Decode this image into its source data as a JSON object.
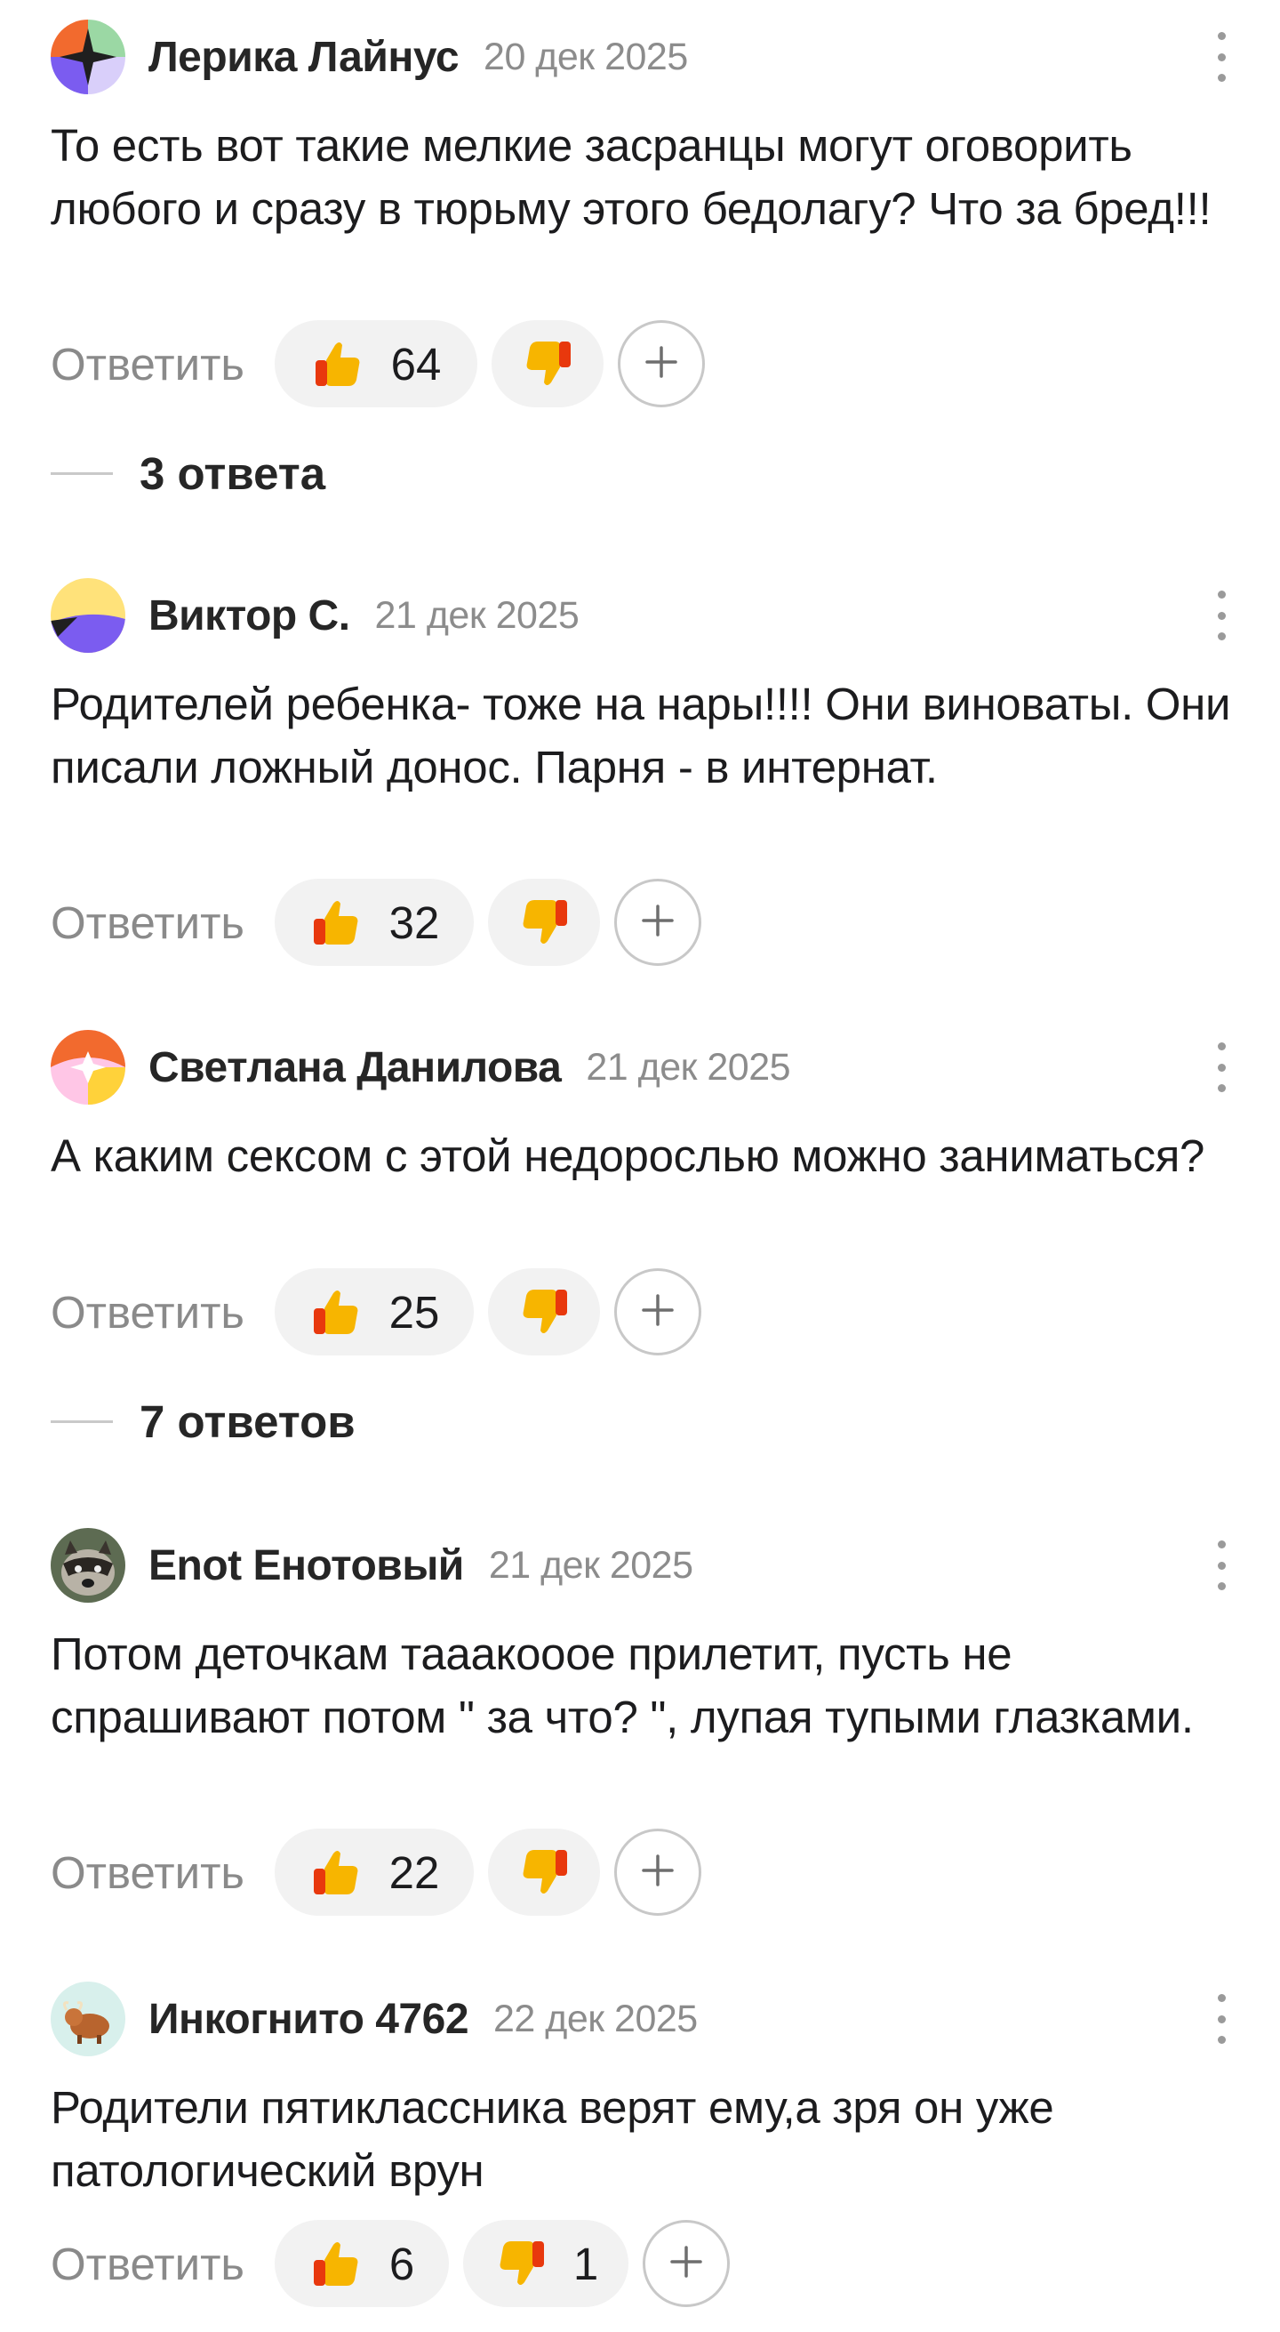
{
  "comments": [
    {
      "author": "Лерика Лайнус",
      "date": "20 дек 2025",
      "text": "То есть вот такие мелкие засранцы могут оговорить любого и сразу в тюрьму этого бедолагу? Что за бред!!!",
      "reply_label": "Ответить",
      "likes": "64",
      "dislikes": "",
      "replies_label": "3 ответа",
      "avatar_icon": "geometric-avatar-orange-green-purple"
    },
    {
      "author": "Виктор С.",
      "date": "21 дек 2025",
      "text": "Родителей ребенка- тоже на нары!!!! Они виноваты. Они писали ложный донос. Парня - в интернат.",
      "reply_label": "Ответить",
      "likes": "32",
      "dislikes": "",
      "avatar_icon": "geometric-avatar-yellow-purple"
    },
    {
      "author": "Светлана Данилова",
      "date": "21 дек 2025",
      "text": "А каким сексом с этой недорослью можно заниматься?",
      "reply_label": "Ответить",
      "likes": "25",
      "dislikes": "",
      "replies_label": "7 ответов",
      "avatar_icon": "geometric-avatar-orange-pink-yellow"
    },
    {
      "author": "Enot Енотовый",
      "date": "21 дек 2025",
      "text": "Потом деточкам тааакоооe прилетит, пусть не спрашивают потом \" за что? \", лупая тупыми глазками.",
      "reply_label": "Ответить",
      "likes": "22",
      "dislikes": "",
      "avatar_icon": "raccoon-photo-avatar"
    },
    {
      "author": "Инкогнито 4762",
      "date": "22 дек 2025",
      "text": "Родители пятиклассника верят ему,а зря он уже патологический врун",
      "reply_label": "Ответить",
      "likes": "6",
      "dislikes": "1",
      "avatar_icon": "yak-avatar"
    }
  ],
  "icons": {
    "like": "thumbs-up-icon",
    "dislike": "thumbs-down-icon",
    "add_reaction": "plus-icon",
    "menu": "more-vertical-icon"
  },
  "colors": {
    "pill_bg": "#f2f2f2",
    "secondary_text": "#8a8a8a",
    "primary_text": "#1c1c1e"
  }
}
